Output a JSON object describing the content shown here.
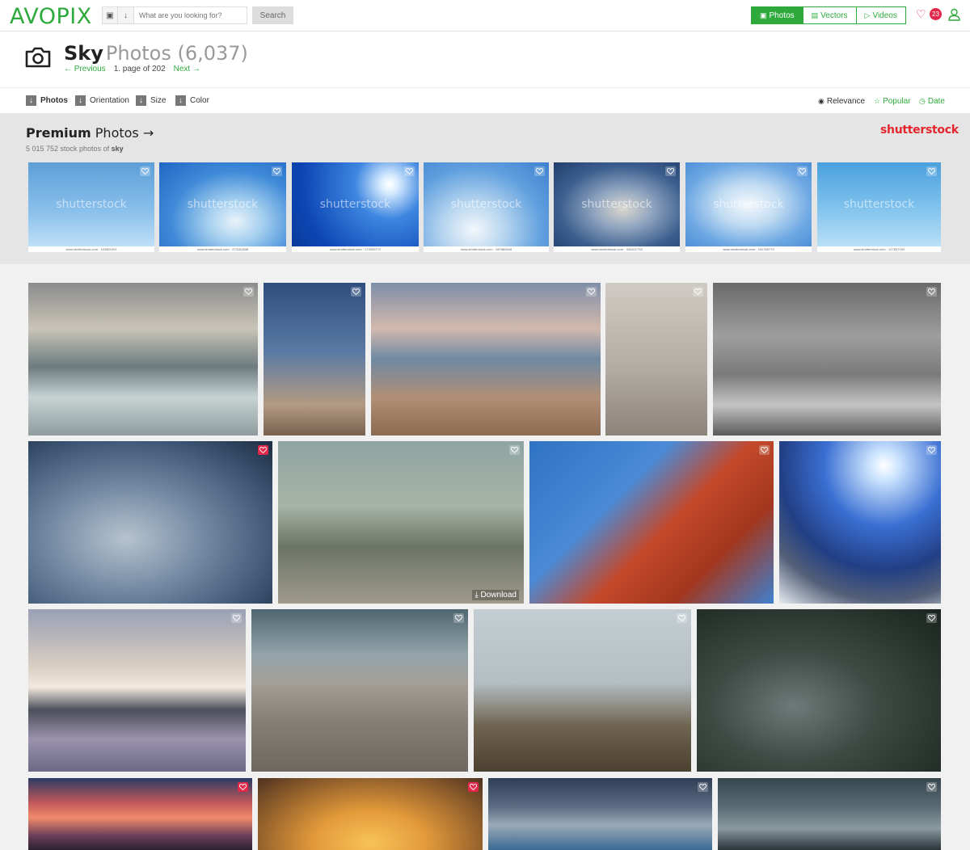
{
  "header": {
    "logo": "AVOPIX",
    "search_placeholder": "What are you looking for?",
    "search_button": "Search",
    "tabs": [
      {
        "label": "Photos",
        "active": true
      },
      {
        "label": "Vectors",
        "active": false
      },
      {
        "label": "Videos",
        "active": false
      }
    ],
    "favorites_count": "23"
  },
  "page": {
    "title": "Sky",
    "title_suffix": "Photos (6,037)",
    "previous": "← Previous",
    "page_info": "1. page of 202",
    "next": "Next →"
  },
  "filters": {
    "items": [
      "Photos",
      "Orientation",
      "Size",
      "Color"
    ],
    "sort": [
      {
        "label": "Relevance",
        "icon": "target-icon",
        "active": true
      },
      {
        "label": "Popular",
        "icon": "star-icon",
        "active": false
      },
      {
        "label": "Date",
        "icon": "clock-icon",
        "active": false
      }
    ]
  },
  "premium": {
    "title_bold": "Premium",
    "title_rest": "Photos →",
    "subtitle_prefix": "5 015 752 stock photos of",
    "subtitle_term": "sky",
    "partner": "shutterstock",
    "watermark": "shutterstock",
    "captions": [
      "www.shutterstock.com · 163801591",
      "www.shutterstock.com · 273152838",
      "www.shutterstock.com · 173329772",
      "www.shutterstock.com · 287880848",
      "www.shutterstock.com · 303421733",
      "www.shutterstock.com · 291769770",
      "www.shutterstock.com · 127837150"
    ]
  },
  "grid": {
    "download_label": "Download",
    "liked": [
      5,
      13,
      14
    ]
  },
  "colors": {
    "brand": "#2eaa3c",
    "favorite": "#e0294a",
    "partner": "#e3262d"
  }
}
